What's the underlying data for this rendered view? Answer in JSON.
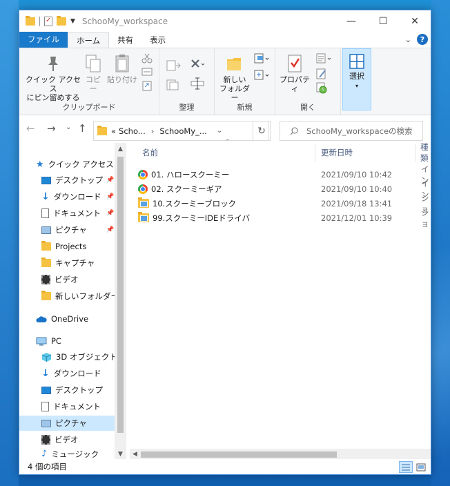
{
  "window": {
    "title": "SchooMy_workspace"
  },
  "window_controls": {
    "minimize": "—",
    "maximize": "☐",
    "close": "✕"
  },
  "ribbon_tabs": [
    {
      "label": "ファイル"
    },
    {
      "label": "ホーム"
    },
    {
      "label": "共有"
    },
    {
      "label": "表示"
    }
  ],
  "ribbon": {
    "pin_label_1": "クイック アクセス",
    "pin_label_2": "にピン留めする",
    "copy": "コピー",
    "paste": "貼り付け",
    "clipboard_group": "クリップボード",
    "organize_group": "整理",
    "new_folder_1": "新しい",
    "new_folder_2": "フォルダー",
    "new_group": "新規",
    "properties": "プロパティ",
    "open_group": "開く",
    "select": "選択"
  },
  "address": {
    "crumb_prefix": "«",
    "crumb_1": "Scho...",
    "sep": "›",
    "crumb_2": "SchooMy_...",
    "search_placeholder": "SchooMy_workspaceの検索"
  },
  "nav": {
    "quick_access": "クイック アクセス",
    "items": [
      {
        "label": "デスクトップ"
      },
      {
        "label": "ダウンロード"
      },
      {
        "label": "ドキュメント"
      },
      {
        "label": "ピクチャ"
      },
      {
        "label": "Projects"
      },
      {
        "label": "キャプチャ"
      },
      {
        "label": "ビデオ"
      },
      {
        "label": "新しいフォルダー"
      }
    ],
    "onedrive": "OneDrive",
    "pc": "PC",
    "pc_items": [
      {
        "label": "3D オブジェクト"
      },
      {
        "label": "ダウンロード"
      },
      {
        "label": "デスクトップ"
      },
      {
        "label": "ドキュメント"
      },
      {
        "label": "ピクチャ"
      },
      {
        "label": "ビデオ"
      },
      {
        "label": "ミュージック"
      }
    ]
  },
  "columns": {
    "name": "名前",
    "date": "更新日時",
    "type": "種類"
  },
  "files": [
    {
      "name": "01. ハロースクーミー",
      "date": "2021/09/10 10:42",
      "type": "イン"
    },
    {
      "name": "02. スクーミーギア",
      "date": "2021/09/10 10:40",
      "type": "イン"
    },
    {
      "name": "10.スクーミーブロック",
      "date": "2021/09/18 13:41",
      "type": "ショ"
    },
    {
      "name": "99.スクーミーIDEドライバ",
      "date": "2021/12/01 10:39",
      "type": "ショ"
    }
  ],
  "status": {
    "count": "4 個の項目"
  }
}
